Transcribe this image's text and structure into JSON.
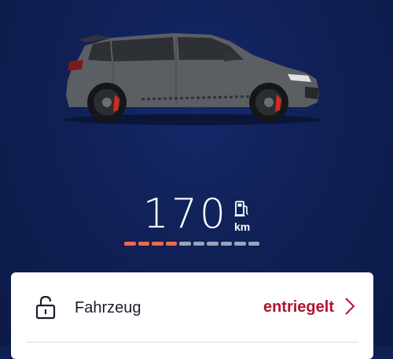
{
  "range": {
    "value": "170",
    "unit": "km",
    "icon": "fuel-pump-icon"
  },
  "fuel_gauge": {
    "segments_total": 10,
    "segments_filled": 4,
    "fill_color": "#ef6a4a",
    "empty_color": "#9aa4b8"
  },
  "status_card": {
    "vehicle_row": {
      "icon": "unlocked-padlock-icon",
      "label": "Fahrzeug",
      "status": "entriegelt",
      "status_color": "#b3132c"
    }
  },
  "colors": {
    "background": "#0f1f52",
    "car_body": "#5b5f63",
    "brake_caliper": "#d22b22"
  }
}
